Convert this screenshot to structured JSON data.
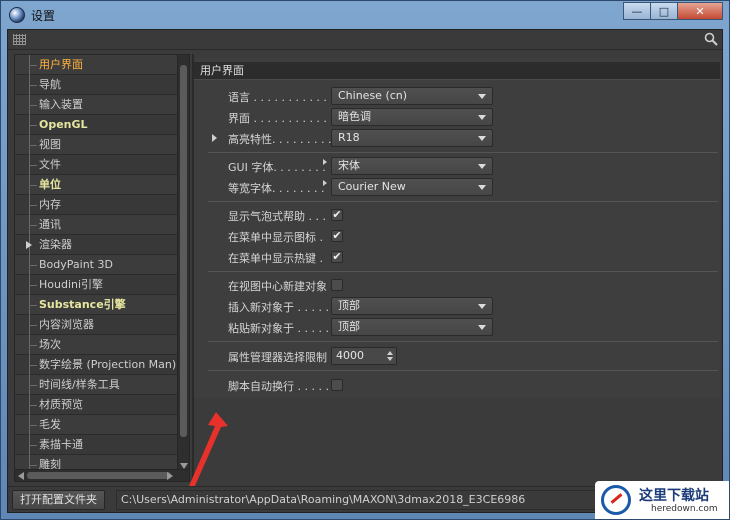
{
  "window": {
    "title": "设置",
    "minimize": "—",
    "maximize": "□",
    "close": "✕"
  },
  "tree": {
    "items": [
      {
        "label": "用户界面",
        "style": "selected"
      },
      {
        "label": "导航",
        "style": "normal"
      },
      {
        "label": "输入装置",
        "style": "normal"
      },
      {
        "label": "OpenGL",
        "style": "bold"
      },
      {
        "label": "视图",
        "style": "normal"
      },
      {
        "label": "文件",
        "style": "normal"
      },
      {
        "label": "单位",
        "style": "bold"
      },
      {
        "label": "内存",
        "style": "normal"
      },
      {
        "label": "通讯",
        "style": "normal"
      },
      {
        "label": "渲染器",
        "style": "expandable"
      },
      {
        "label": "BodyPaint 3D",
        "style": "normal"
      },
      {
        "label": "Houdini引擎",
        "style": "normal"
      },
      {
        "label": "Substance引擎",
        "style": "bold"
      },
      {
        "label": "内容浏览器",
        "style": "normal"
      },
      {
        "label": "场次",
        "style": "normal"
      },
      {
        "label": "数字绘景 (Projection Man)",
        "style": "normal"
      },
      {
        "label": "时间线/样条工具",
        "style": "normal"
      },
      {
        "label": "材质预览",
        "style": "normal"
      },
      {
        "label": "毛发",
        "style": "normal"
      },
      {
        "label": "素描卡通",
        "style": "normal"
      },
      {
        "label": "雕刻",
        "style": "normal"
      }
    ]
  },
  "panel": {
    "header": "用户界面",
    "language": {
      "label": "语言 . . . . . . . . . . . .",
      "value": "Chinese (cn)"
    },
    "scheme": {
      "label": "界面 . . . . . . . . . . . .",
      "value": "暗色调"
    },
    "highlight": {
      "label": "高亮特性. . . . . . . . . .",
      "value": "R18"
    },
    "gui_font": {
      "label": "GUI 字体. . . . . . . .",
      "value": "宋体"
    },
    "mono_font": {
      "label": "等宽字体. . . . . . . .",
      "value": "Courier New"
    },
    "bubble_help": {
      "label": "显示气泡式帮助 . . ."
    },
    "menu_icons": {
      "label": "在菜单中显示图标 ."
    },
    "menu_hotkeys": {
      "label": "在菜单中显示热键 ."
    },
    "new_at_center": {
      "label": "在视图中心新建对象"
    },
    "insert_at": {
      "label": "插入新对象于 . . . . .",
      "value": "顶部"
    },
    "paste_at": {
      "label": "粘贴新对象于 . . . . .",
      "value": "顶部"
    },
    "attr_limit": {
      "label": "属性管理器选择限制",
      "value": "4000"
    },
    "script_wrap": {
      "label": "脚本自动换行 . . . . ."
    }
  },
  "checks": {
    "bubble_help": true,
    "menu_icons": true,
    "menu_hotkeys": true,
    "new_at_center": false,
    "script_wrap": false
  },
  "bottom": {
    "open_button": "打开配置文件夹",
    "path": "C:\\Users\\Administrator\\AppData\\Roaming\\MAXON\\3dmax2018_E3CE6986"
  },
  "watermark": {
    "title": "这里下载站",
    "sub": "heredown.com"
  },
  "colors": {
    "selected_item": "#ffb340",
    "bold_item": "#e6e6a0",
    "annotation_arrow": "#e8312a"
  }
}
